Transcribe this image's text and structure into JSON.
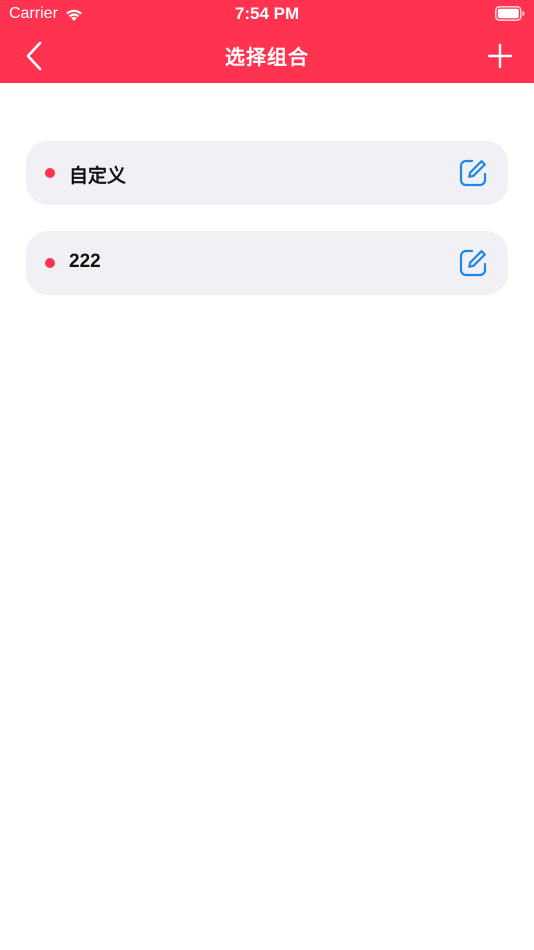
{
  "status_bar": {
    "carrier": "Carrier",
    "time": "7:54 PM"
  },
  "nav": {
    "title": "选择组合",
    "back_icon": "chevron-left-icon",
    "add_icon": "plus-icon"
  },
  "groups": [
    {
      "label": "自定义"
    },
    {
      "label": "222"
    }
  ],
  "colors": {
    "accent": "#ff3350",
    "item_background": "#f1f1f5",
    "edit_icon": "#1e88e5"
  }
}
